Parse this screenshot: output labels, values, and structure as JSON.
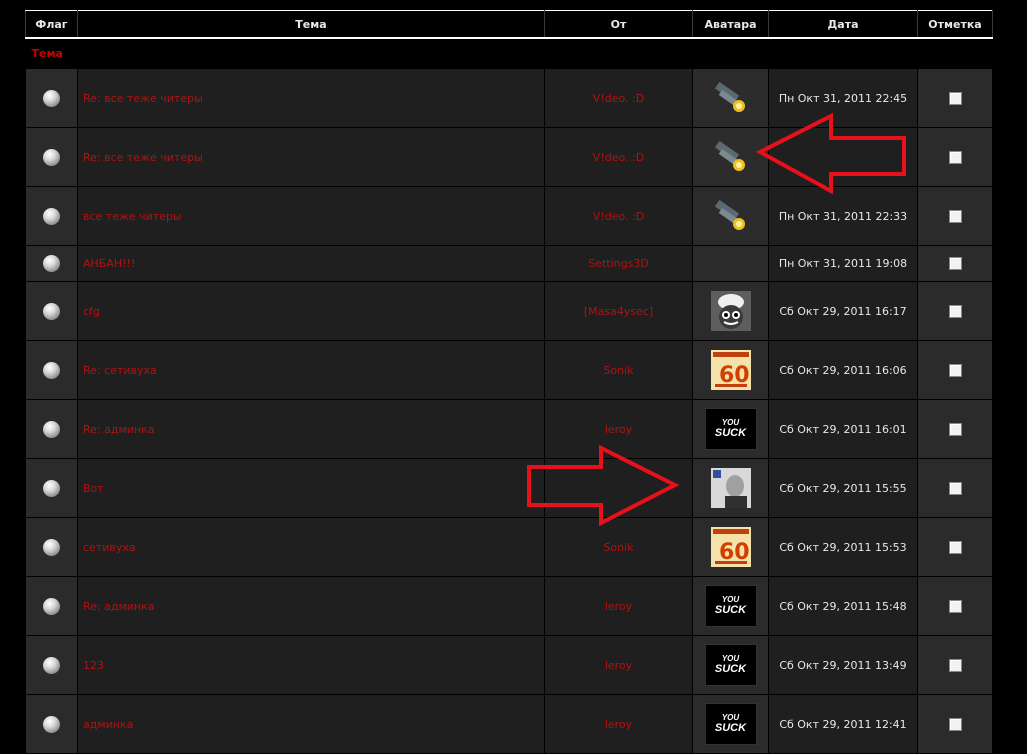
{
  "headers": {
    "flag": "Флаг",
    "topic": "Тема",
    "from": "От",
    "avatar": "Аватара",
    "date": "Дата",
    "mark": "Отметка"
  },
  "section_label": "Тема",
  "rows": [
    {
      "topic": "Re: все теже читеры",
      "from": "V!deo. :D",
      "avatar": "mech-avatar",
      "date": "Пн Окт 31, 2011 22:45"
    },
    {
      "topic": "Re: все теже читеры",
      "from": "V!deo. :D",
      "avatar": "mech-avatar",
      "date": ""
    },
    {
      "topic": "все теже читеры",
      "from": "V!deo. :D",
      "avatar": "mech-avatar",
      "date": "Пн Окт 31, 2011 22:33"
    },
    {
      "topic": "АНБАН!!!",
      "from": "Settings3D",
      "avatar": "",
      "date": "Пн Окт 31, 2011 19:08"
    },
    {
      "topic": "cfg",
      "from": "[Masa4ysec]",
      "avatar": "ghost-avatar",
      "date": "Сб Окт 29, 2011 16:17"
    },
    {
      "topic": "Re: сетивуха",
      "from": "Sonik",
      "avatar": "demotivator-avatar",
      "date": "Сб Окт 29, 2011 16:06"
    },
    {
      "topic": "Re: админка",
      "from": "leroy",
      "avatar": "you-suck-avatar",
      "date": "Сб Окт 29, 2011 16:01"
    },
    {
      "topic": "Вот",
      "from": "",
      "avatar": "photo-avatar",
      "date": "Сб Окт 29, 2011 15:55"
    },
    {
      "topic": "сетивуха",
      "from": "Sonik",
      "avatar": "demotivator-avatar",
      "date": "Сб Окт 29, 2011 15:53"
    },
    {
      "topic": "Re: админка",
      "from": "leroy",
      "avatar": "you-suck-avatar",
      "date": "Сб Окт 29, 2011 15:48"
    },
    {
      "topic": "123",
      "from": "leroy",
      "avatar": "you-suck-avatar",
      "date": "Сб Окт 29, 2011 13:49"
    },
    {
      "topic": "админка",
      "from": "leroy",
      "avatar": "you-suck-avatar",
      "date": "Сб Окт 29, 2011 12:41"
    }
  ],
  "you_suck": {
    "line1": "YOU",
    "line2": "SUCK"
  },
  "colors": {
    "link": "#b01212",
    "section": "#cc0000",
    "arrow": "#e8101a"
  }
}
